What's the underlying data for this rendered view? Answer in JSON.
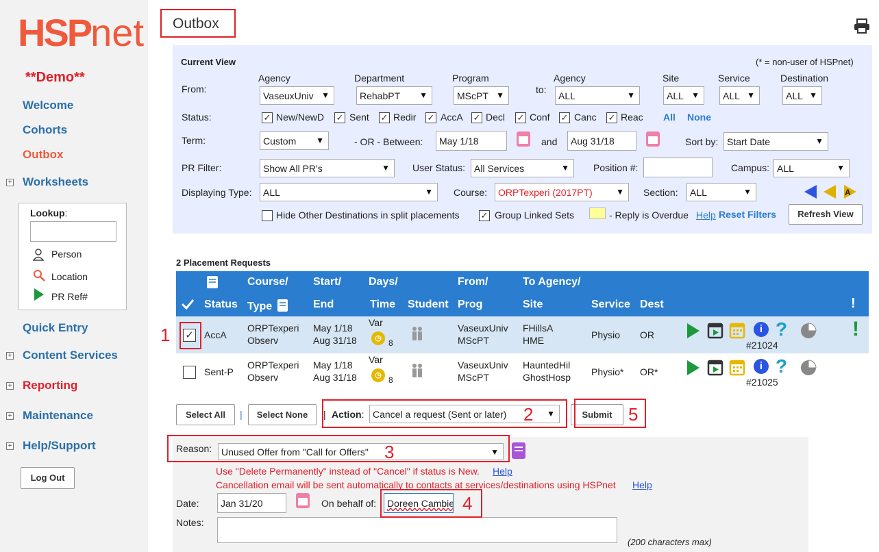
{
  "app": {
    "logo_main": "HSP",
    "logo_suffix": "net",
    "demo_label": "**Demo**"
  },
  "sidebar": {
    "items": [
      {
        "label": "Welcome"
      },
      {
        "label": "Cohorts"
      },
      {
        "label": "Outbox"
      },
      {
        "label": "Worksheets"
      },
      {
        "label": "Quick Entry"
      },
      {
        "label": "Content Services"
      },
      {
        "label": "Reporting"
      },
      {
        "label": "Maintenance"
      },
      {
        "label": "Help/Support"
      }
    ],
    "lookup": {
      "title": "Lookup",
      "colon": ":",
      "person": "Person",
      "location": "Location",
      "prref": "PR Ref#"
    },
    "logout": "Log Out"
  },
  "page": {
    "title": "Outbox"
  },
  "filters": {
    "current_view": "Current View",
    "non_user_note": "(* = non-user of HSPnet)",
    "from_label": "From:",
    "to_label": "to:",
    "agency_label": "Agency",
    "department_label": "Department",
    "program_label": "Program",
    "agency2_label": "Agency",
    "site_label": "Site",
    "service_label": "Service",
    "destination_label": "Destination",
    "from_agency": "VaseuxUniv",
    "department": "RehabPT",
    "program": "MScPT",
    "to_agency": "ALL",
    "site": "ALL",
    "service": "ALL",
    "destination": "ALL",
    "status_label": "Status:",
    "statuses": [
      "New/NewD",
      "Sent",
      "Redir",
      "AccA",
      "Decl",
      "Conf",
      "Canc",
      "Reac"
    ],
    "all_link": "All",
    "none_link": "None",
    "term_label": "Term:",
    "term": "Custom",
    "or_between": "- OR -  Between:",
    "start_date": "May 1/18",
    "and_label": "and",
    "end_date": "Aug 31/18",
    "sort_label": "Sort by:",
    "sort": "Start Date",
    "pr_filter_label": "PR Filter:",
    "pr_filter": "Show All PR's",
    "user_status_label": "User Status:",
    "user_status": "All Services",
    "position_label": "Position #:",
    "position_value": "",
    "campus_label": "Campus:",
    "campus": "ALL",
    "displaying_label": "Displaying Type:",
    "displaying": "ALL",
    "course_label": "Course:",
    "course": "ORPTexperi (2017PT)",
    "section_label": "Section:",
    "section": "ALL",
    "hide_other": "Hide Other Destinations in split placements",
    "group_linked": "Group Linked Sets",
    "overdue": "- Reply is Overdue",
    "help": "Help",
    "reset": "Reset Filters",
    "refresh": "Refresh View"
  },
  "table": {
    "count_label": "2 Placement Requests",
    "headers": {
      "status": "Status",
      "course1": "Course/",
      "course2": "Type",
      "start1": "Start/",
      "start2": "End",
      "days1": "Days/",
      "days2": "Time",
      "student": "Student",
      "from1": "From/",
      "from2": "Prog",
      "to1": "To Agency/",
      "to2": "Site",
      "service": "Service",
      "dest": "Dest",
      "alert": "!"
    },
    "rows": [
      {
        "status": "AccA",
        "course": "ORPTexperi",
        "type": "Observ",
        "start": "May 1/18",
        "end": "Aug 31/18",
        "days": "Var",
        "time": "8",
        "from": "VaseuxUniv",
        "prog": "MScPT",
        "to": "FHillsA",
        "site": "HME",
        "service": "Physio",
        "dest": "OR",
        "ref": "#21024",
        "alert": "!"
      },
      {
        "status": "Sent-P",
        "course": "ORPTexperi",
        "type": "Observ",
        "start": "May 1/18",
        "end": "Aug 31/18",
        "days": "Var",
        "time": "8",
        "from": "VaseuxUniv",
        "prog": "MScPT",
        "to": "HauntedHil",
        "site": "GhostHosp",
        "service": "Physio*",
        "dest": "OR*",
        "ref": "#21025",
        "alert": ""
      }
    ]
  },
  "actions": {
    "select_all": "Select All",
    "sep": "|",
    "select_none": "Select None",
    "sep2": "|",
    "action_label": "Action",
    "action_colon": ":",
    "action_value": "Cancel a request (Sent or later)",
    "submit": "Submit"
  },
  "cancel_form": {
    "reason_label": "Reason:",
    "reason": "Unused Offer from \"Call for Offers\"",
    "warn1": "Use \"Delete Permanently\" instead of \"Cancel\" if status is New.",
    "warn2": "Cancellation email will be sent automatically to contacts at services/destinations using HSPnet",
    "help": "Help",
    "date_label": "Date:",
    "date": "Jan 31/20",
    "behalf_label": "On behalf of:",
    "behalf": "Doreen Cambie",
    "notes_label": "Notes:",
    "max_note": "(200 characters max)"
  },
  "annotations": [
    "1",
    "2",
    "3",
    "4",
    "5"
  ],
  "colors": {
    "accent": "#2a7dcf",
    "brand": "#f05a3c",
    "annotation": "#e0202a",
    "filter_bg": "#e8edff",
    "row_selected": "#d6e6f5"
  }
}
